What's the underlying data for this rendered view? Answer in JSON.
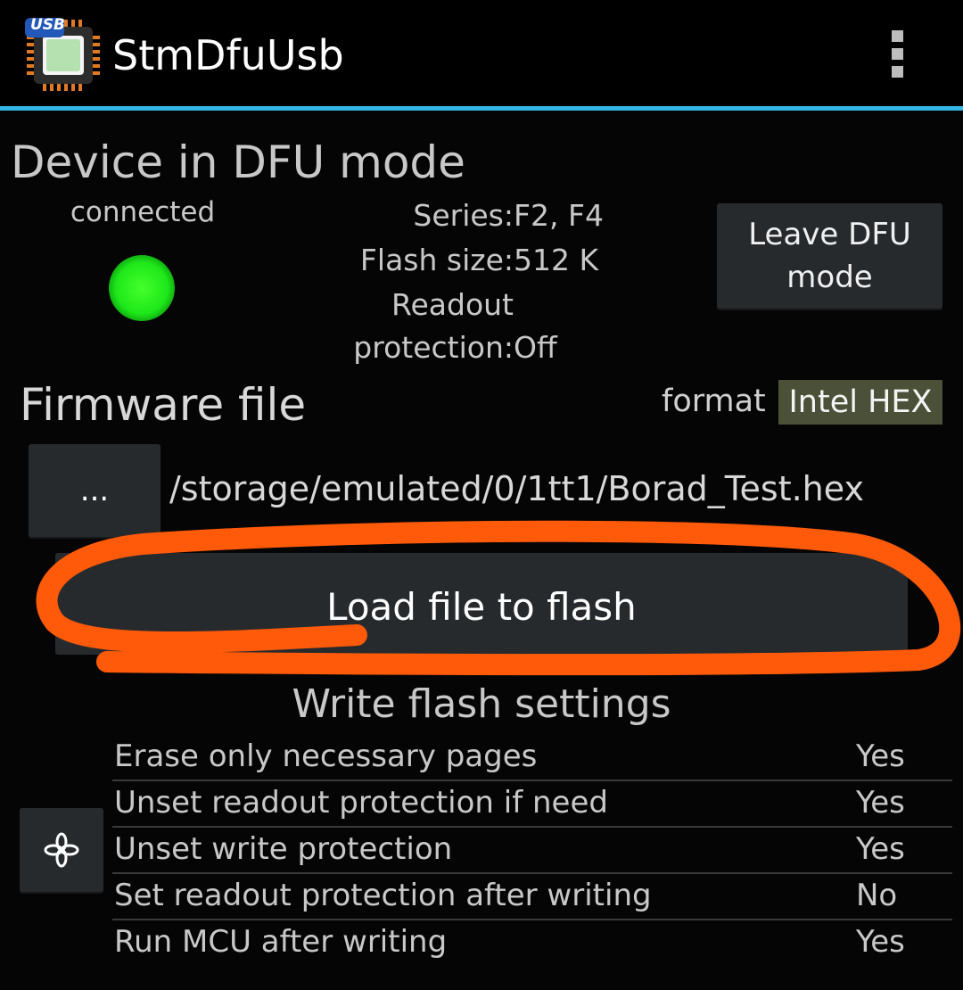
{
  "app": {
    "title": "StmDfuUsb",
    "icon_badge": "USB",
    "accent_color": "#33b5e5"
  },
  "device": {
    "title": "Device in DFU mode",
    "status": "connected",
    "led_color": "#1ee81a",
    "series_label": "Series:",
    "series_value": "F2, F4",
    "flash_label": "Flash size:",
    "flash_value": "512 K",
    "readout_label_line1": "Readout",
    "readout_label_line2": "protection:",
    "readout_value": "Off",
    "leave_button": "Leave DFU mode"
  },
  "firmware": {
    "title": "Firmware file",
    "format_label": "format",
    "format_value": "Intel HEX",
    "browse_button": "...",
    "file_path": "/storage/emulated/0/1tt1/Borad_Test.hex",
    "load_button": "Load file to flash",
    "highlight_color": "#ff5a0a"
  },
  "settings": {
    "title": "Write flash settings",
    "button_icon": "asterisk-icon",
    "rows": [
      {
        "label": "Erase only necessary pages",
        "value": "Yes"
      },
      {
        "label": "Unset readout protection if need",
        "value": "Yes"
      },
      {
        "label": "Unset write protection",
        "value": "Yes"
      },
      {
        "label": "Set readout protection after writing",
        "value": "No"
      },
      {
        "label": "Run MCU after writing",
        "value": "Yes"
      }
    ]
  }
}
